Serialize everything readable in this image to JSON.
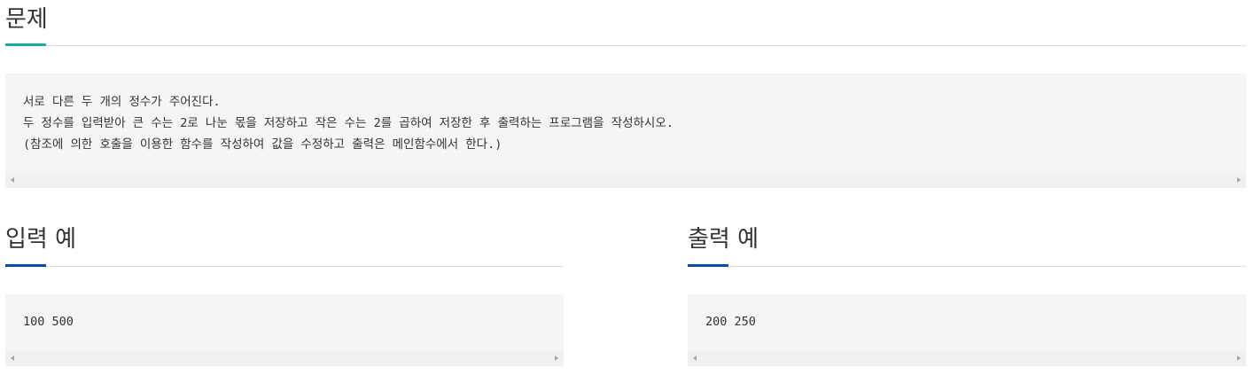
{
  "problem": {
    "title": "문제",
    "accent_color": "#1aae9f",
    "lines": [
      "서로 다른 두 개의 정수가 주어진다.",
      "두 정수를 입력받아 큰 수는 2로 나눈 몫을 저장하고 작은 수는 2를 곱하여 저장한 후 출력하는 프로그램을 작성하시오.",
      "(참조에 의한 호출을 이용한 함수를 작성하여 값을 수정하고 출력은 메인함수에서 한다.)"
    ]
  },
  "input_example": {
    "title": "입력 예",
    "accent_color": "#0d4ca3",
    "text": "100 500"
  },
  "output_example": {
    "title": "출력 예",
    "accent_color": "#0d4ca3",
    "text": "200 250"
  },
  "scrollbar_arrow_icons": [
    "caret-left-icon",
    "caret-right-icon"
  ]
}
